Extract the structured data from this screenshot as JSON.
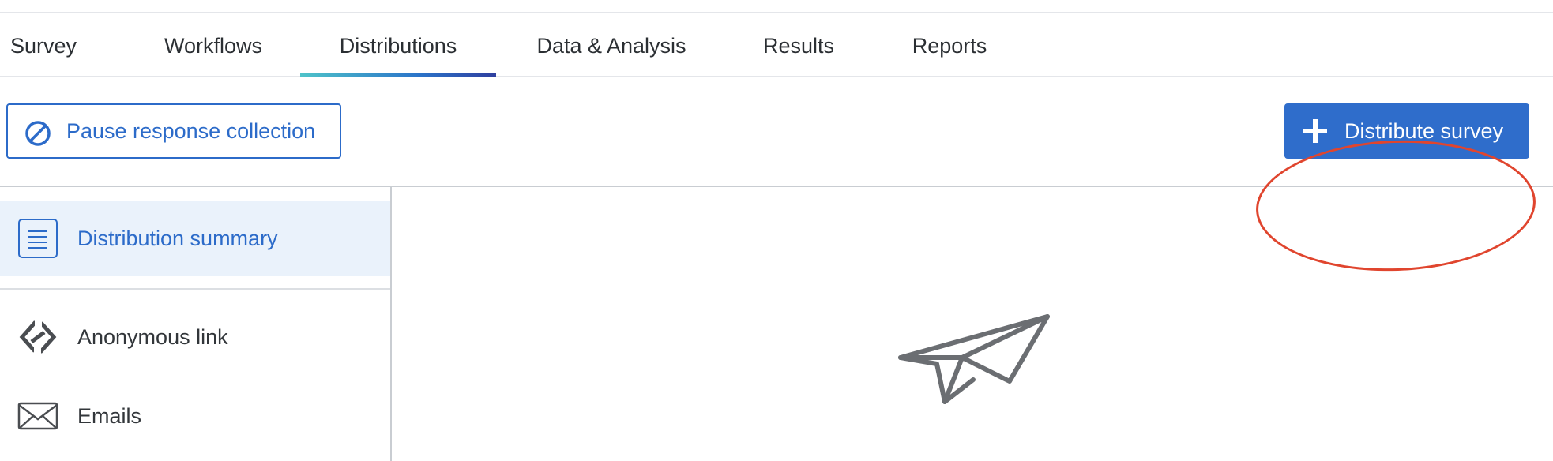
{
  "nav": {
    "tabs": [
      {
        "label": "Survey",
        "active": false
      },
      {
        "label": "Workflows",
        "active": false
      },
      {
        "label": "Distributions",
        "active": true
      },
      {
        "label": "Data & Analysis",
        "active": false
      },
      {
        "label": "Results",
        "active": false
      },
      {
        "label": "Reports",
        "active": false
      }
    ]
  },
  "toolbar": {
    "pause_label": "Pause response collection",
    "pause_icon": "prohibited-icon",
    "distribute_label": "Distribute survey",
    "distribute_icon": "plus-icon",
    "highlight_color": "#e0452e"
  },
  "sidebar": {
    "items": [
      {
        "label": "Distribution summary",
        "icon": "list-icon",
        "selected": true
      },
      {
        "label": "Anonymous link",
        "icon": "link-icon",
        "selected": false
      },
      {
        "label": "Emails",
        "icon": "envelope-icon",
        "selected": false
      }
    ]
  },
  "main": {
    "empty_state_icon": "paper-plane-icon"
  },
  "colors": {
    "accent": "#2c6bc9",
    "primary_button": "#2f6dcb",
    "selected_bg": "#eaf2fb"
  }
}
